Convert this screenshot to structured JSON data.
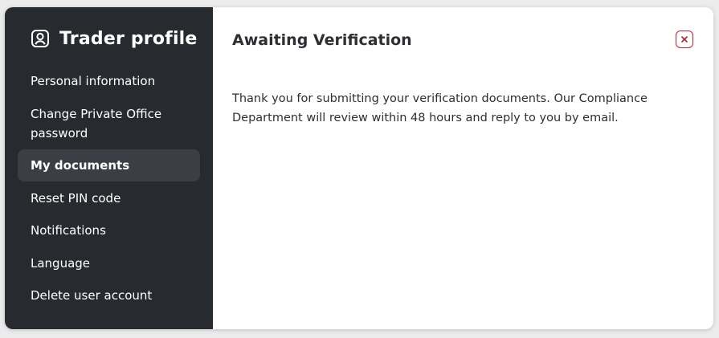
{
  "sidebar": {
    "title": "Trader profile",
    "title_icon": "user-icon",
    "items": [
      {
        "label": "Personal information",
        "active": false
      },
      {
        "label": "Change Private Office password",
        "active": false
      },
      {
        "label": "My documents",
        "active": true
      },
      {
        "label": "Reset PIN code",
        "active": false
      },
      {
        "label": "Notifications",
        "active": false
      },
      {
        "label": "Language",
        "active": false
      },
      {
        "label": "Delete user account",
        "active": false
      }
    ]
  },
  "main": {
    "title": "Awaiting Verification",
    "close_icon": "close-icon",
    "message": "Thank you for submitting your verification documents. Our Compliance Department will review within 48 hours and reply to you by email."
  },
  "colors": {
    "sidebar_bg": "#272b2f",
    "active_item_bg": "#3b3f45",
    "close_accent": "#b4232f"
  }
}
